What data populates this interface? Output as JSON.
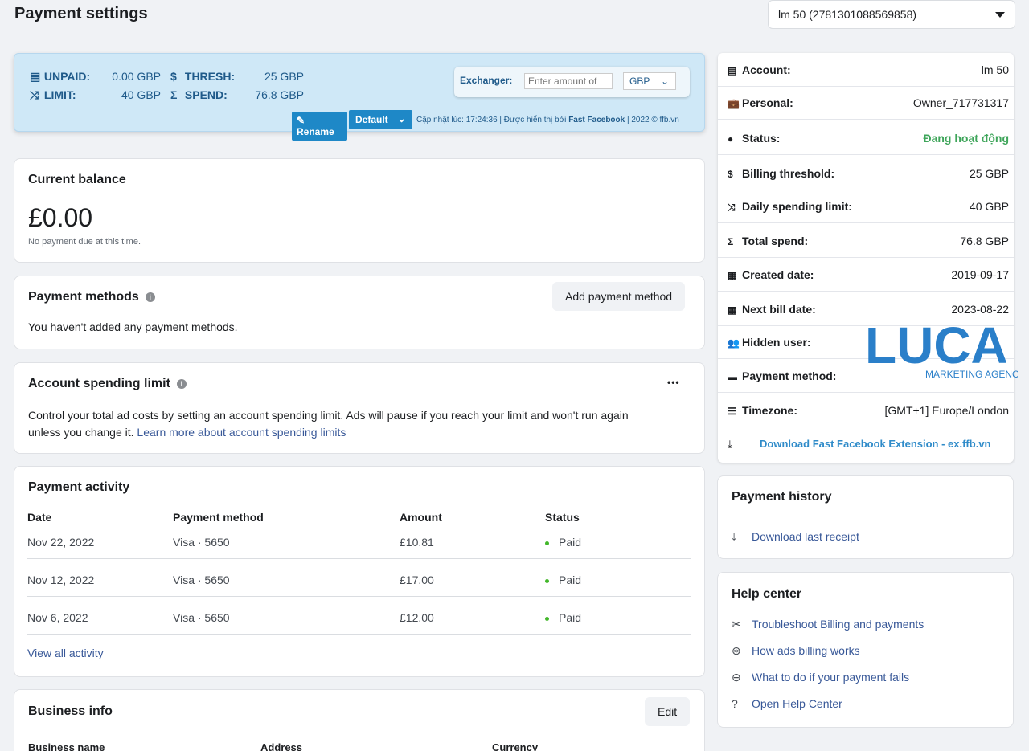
{
  "page": {
    "title": "Payment settings"
  },
  "account_selector": {
    "value": "lm 50 (2781301088569858)"
  },
  "extension": {
    "unpaid_label": "UNPAID:",
    "unpaid_value": "0.00 GBP",
    "thresh_label": "THRESH:",
    "thresh_value": "25 GBP",
    "limit_label": "LIMIT:",
    "limit_value": "40 GBP",
    "spend_label": "SPEND:",
    "spend_value": "76.8 GBP",
    "exchanger_label": "Exchanger:",
    "exchanger_placeholder": "Enter amount of",
    "currency": "GBP",
    "rename_label": "Rename",
    "default_label": "Default",
    "update_prefix": "Cập nhật lúc: 17:24:36 | Được hiển thị bởi ",
    "update_brand": "Fast Facebook",
    "update_suffix": " | 2022 © ffb.vn"
  },
  "current_balance": {
    "title": "Current balance",
    "amount": "£0.00",
    "note": "No payment due at this time."
  },
  "payment_methods": {
    "title": "Payment methods",
    "add_label": "Add payment method",
    "empty_text": "You haven't added any payment methods."
  },
  "spending_limit": {
    "title": "Account spending limit",
    "more_label": "•••",
    "desc": "Control your total ad costs by setting an account spending limit. Ads will pause if you reach your limit and won't run again",
    "desc2": "unless you change it. ",
    "link": "Learn more about account spending limits"
  },
  "payment_activity": {
    "title": "Payment activity",
    "headers": {
      "date": "Date",
      "method": "Payment method",
      "amount": "Amount",
      "status": "Status"
    },
    "rows": [
      {
        "date": "Nov 22, 2022",
        "method": "Visa · 5650",
        "amount": "£10.81",
        "status": "Paid"
      },
      {
        "date": "Nov 12, 2022",
        "method": "Visa · 5650",
        "amount": "£17.00",
        "status": "Paid"
      },
      {
        "date": "Nov 6, 2022",
        "method": "Visa · 5650",
        "amount": "£12.00",
        "status": "Paid"
      }
    ],
    "view_all": "View all activity"
  },
  "business_info": {
    "title": "Business info",
    "edit_label": "Edit",
    "col_name": "Business name",
    "col_address": "Address",
    "col_currency": "Currency"
  },
  "account_info": {
    "rows": [
      {
        "key": "Account:",
        "value": "lm 50",
        "icon": "document-icon"
      },
      {
        "key": "Personal:",
        "value": "Owner_717731317",
        "icon": "briefcase-icon"
      },
      {
        "key": "Status:",
        "value": "Đang hoạt động",
        "icon": "check-circle-icon"
      },
      {
        "key": "Billing threshold:",
        "value": "25 GBP",
        "icon": "file-dollar-icon"
      },
      {
        "key": "Daily spending limit:",
        "value": "40 GBP",
        "icon": "shuffle-icon"
      },
      {
        "key": "Total spend:",
        "value": "76.8 GBP",
        "icon": "sigma-icon"
      },
      {
        "key": "Created date:",
        "value": "2019-09-17",
        "icon": "calendar-plus-icon"
      },
      {
        "key": "Next bill date:",
        "value": "2023-08-22",
        "icon": "calendar-plus-icon"
      },
      {
        "key": "Hidden user:",
        "value": "",
        "icon": "users-icon"
      },
      {
        "key": "Payment method:",
        "value": "",
        "icon": "credit-card-icon"
      },
      {
        "key": "Timezone:",
        "value": "[GMT+1] Europe/London",
        "icon": "list-icon"
      }
    ],
    "status_color": "#3ea55a",
    "download_link": "Download Fast Facebook Extension - ex.ffb.vn"
  },
  "payment_history": {
    "title": "Payment history",
    "download_receipt": "Download last receipt"
  },
  "help_center": {
    "title": "Help center",
    "items": [
      {
        "label": "Troubleshoot Billing and payments",
        "icon": "tools-icon"
      },
      {
        "label": "How ads billing works",
        "icon": "billing-icon"
      },
      {
        "label": "What to do if your payment fails",
        "icon": "minus-circle-icon"
      },
      {
        "label": "Open Help Center",
        "icon": "question-circle-icon"
      }
    ]
  },
  "watermark": {
    "brand": "LUCA",
    "tagline": "MARKETING AGENCY"
  },
  "colors": {
    "accent_blue": "#1e88c7",
    "link": "#385898",
    "ext_bg": "#cfe8f7",
    "paid": "#42b72a"
  }
}
